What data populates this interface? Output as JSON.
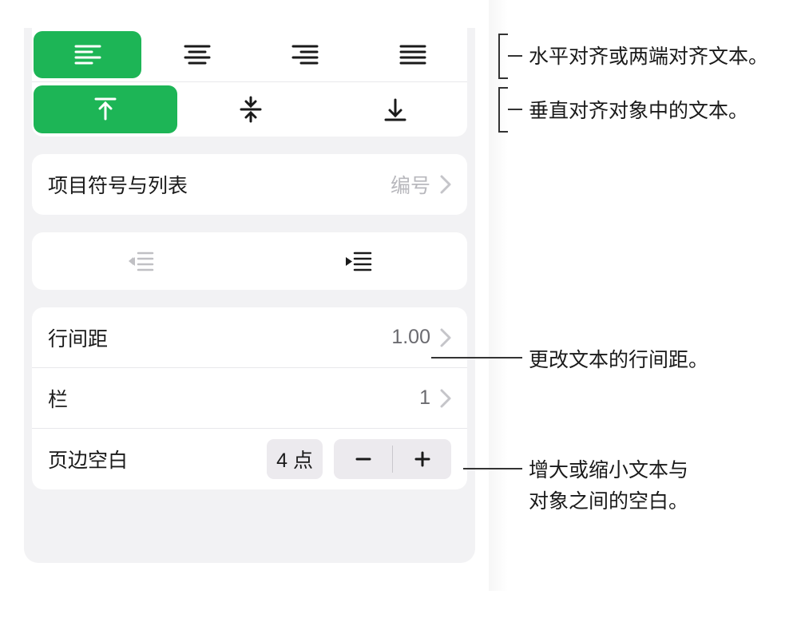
{
  "bullets": {
    "label": "项目符号与列表",
    "value": "编号"
  },
  "lineSpacing": {
    "label": "行间距",
    "value": "1.00"
  },
  "columns": {
    "label": "栏",
    "value": "1"
  },
  "margins": {
    "label": "页边空白",
    "value": "4 点"
  },
  "annotations": {
    "halign": "水平对齐或两端对齐文本。",
    "valign": "垂直对齐对象中的文本。",
    "lineSpacing": "更改文本的行间距。",
    "margins1": "增大或缩小文本与",
    "margins2": "对象之间的空白。"
  },
  "colors": {
    "accent": "#1db556"
  }
}
